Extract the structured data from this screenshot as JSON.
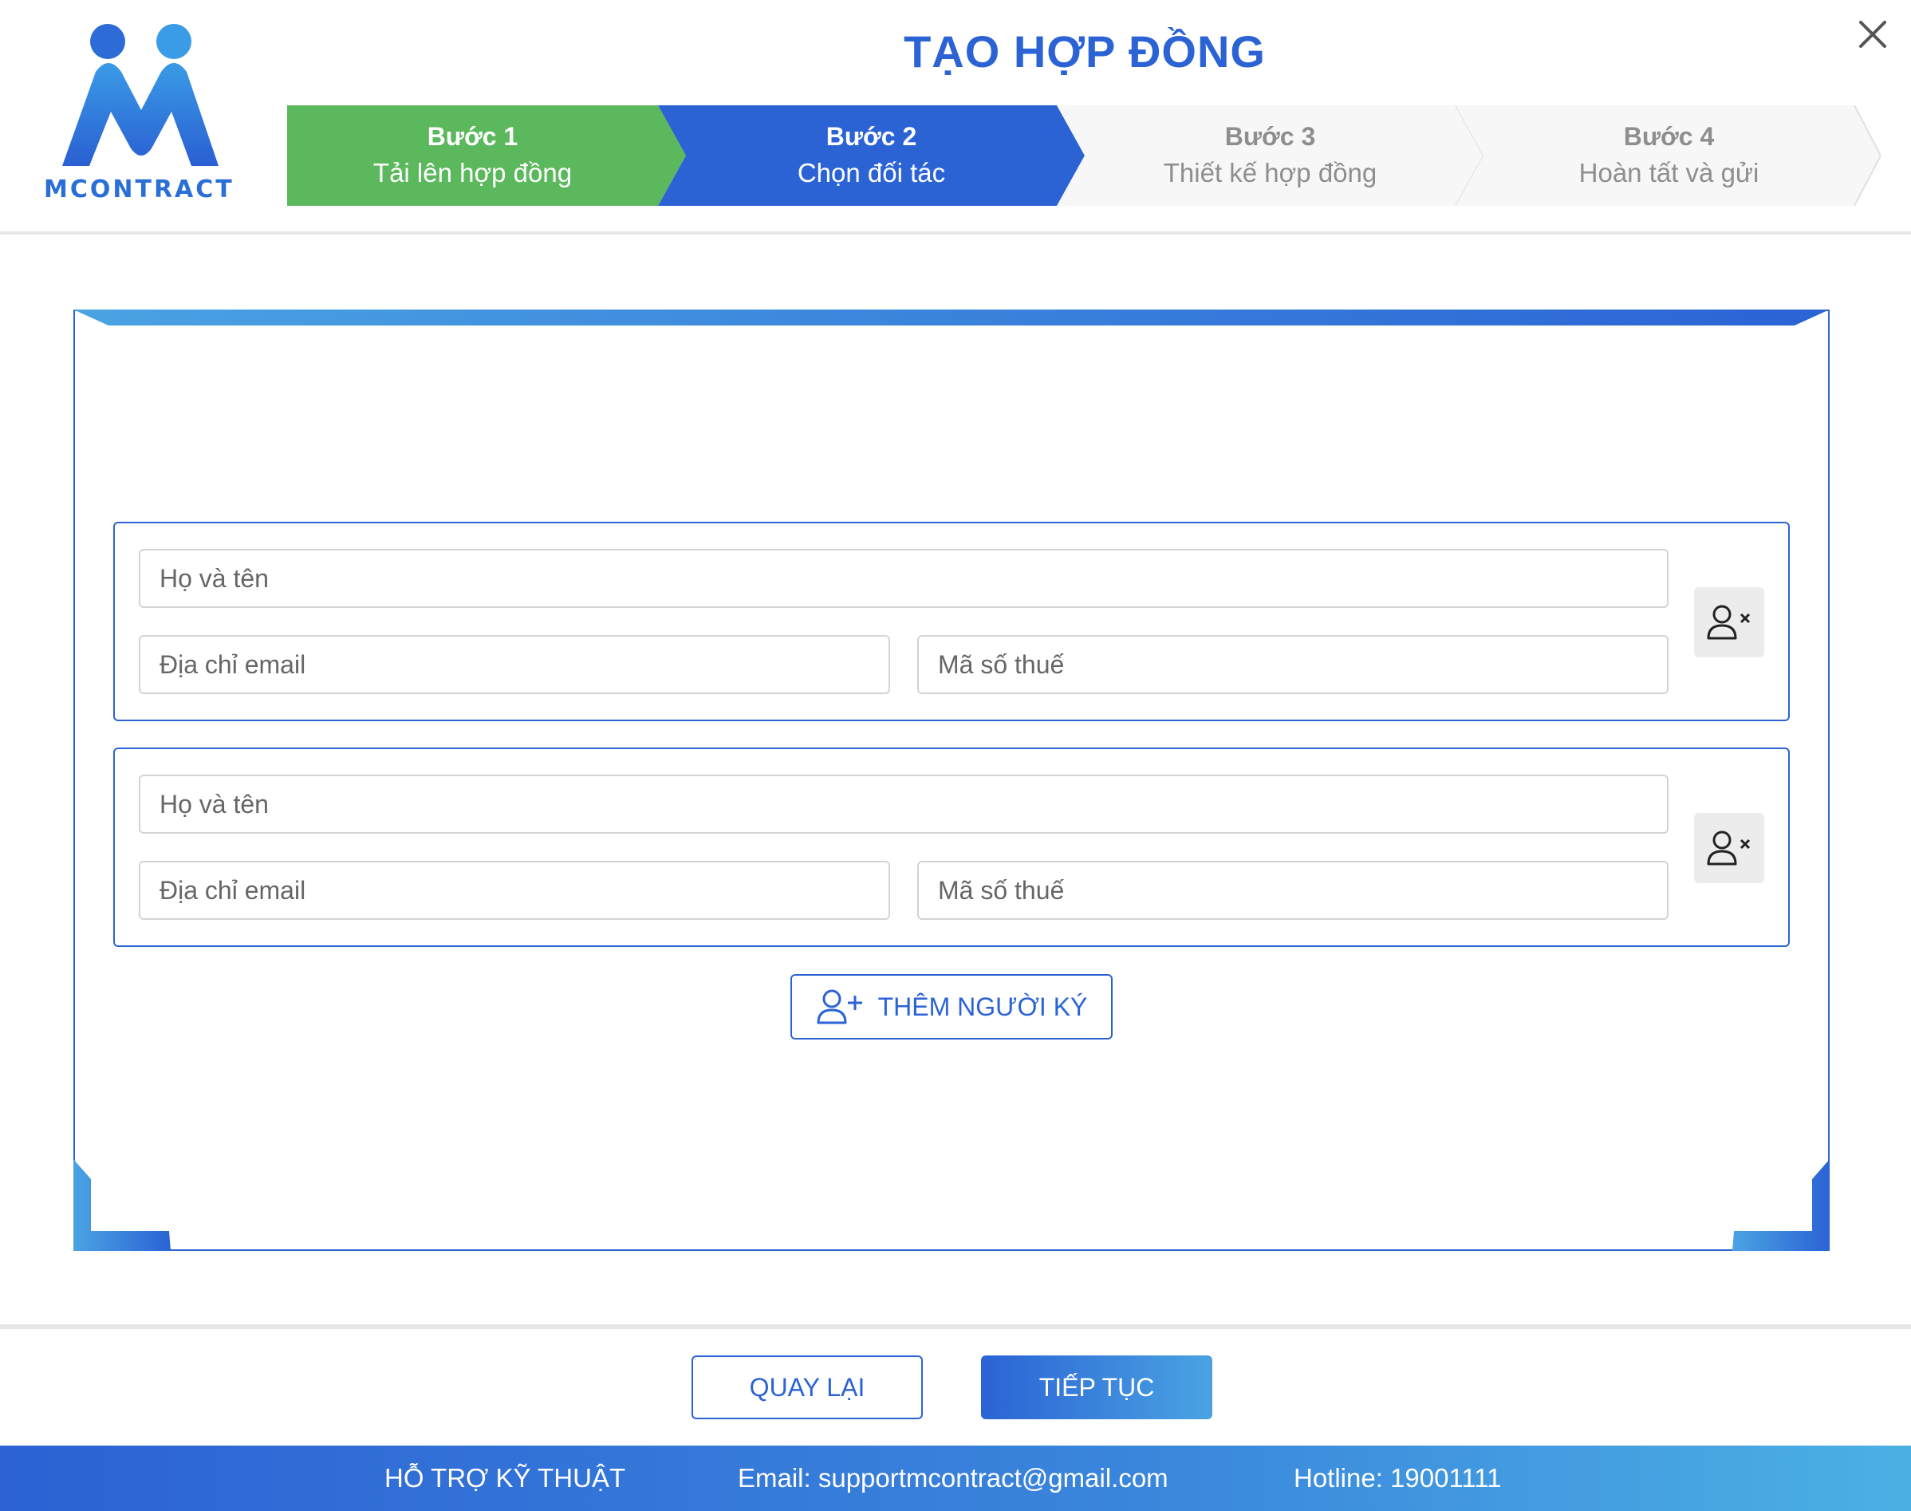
{
  "app": {
    "logo_text": "MCONTRACT",
    "title": "TẠO HỢP ĐỒNG"
  },
  "steps": [
    {
      "label": "Bước 1",
      "description": "Tải lên hợp đồng",
      "state": "completed",
      "color": "#5cb85c"
    },
    {
      "label": "Bước 2",
      "description": "Chọn đối tác",
      "state": "active",
      "color": "#2b63d5"
    },
    {
      "label": "Bước 3",
      "description": "Thiết kế hợp đồng",
      "state": "pending",
      "color": "#f7f7f7"
    },
    {
      "label": "Bước 4",
      "description": "Hoàn tất và gửi",
      "state": "pending",
      "color": "#f7f7f7"
    }
  ],
  "signers": [
    {
      "name_placeholder": "Họ và tên",
      "email_placeholder": "Địa chỉ email",
      "tax_placeholder": "Mã số thuế",
      "name_value": "",
      "email_value": "",
      "tax_value": "",
      "remove_icon": "user-remove-icon"
    },
    {
      "name_placeholder": "Họ và tên",
      "email_placeholder": "Địa chỉ email",
      "tax_placeholder": "Mã số thuế",
      "name_value": "",
      "email_value": "",
      "tax_value": "",
      "remove_icon": "user-remove-icon"
    }
  ],
  "add_signer": {
    "label": "THÊM NGƯỜI KÝ",
    "icon": "user-add-icon"
  },
  "actions": {
    "back_label": "QUAY LẠI",
    "next_label": "TIẾP TỤC"
  },
  "footer": {
    "support_label": "HỖ TRỢ KỸ THUẬT",
    "email_text": "Email: supportmcontract@gmail.com",
    "hotline_text": "Hotline: 19001111"
  },
  "colors": {
    "primary": "#2b63d5",
    "accent": "#4aa3e3",
    "completed": "#5cb85c",
    "pending_text": "#8e8e8e"
  }
}
